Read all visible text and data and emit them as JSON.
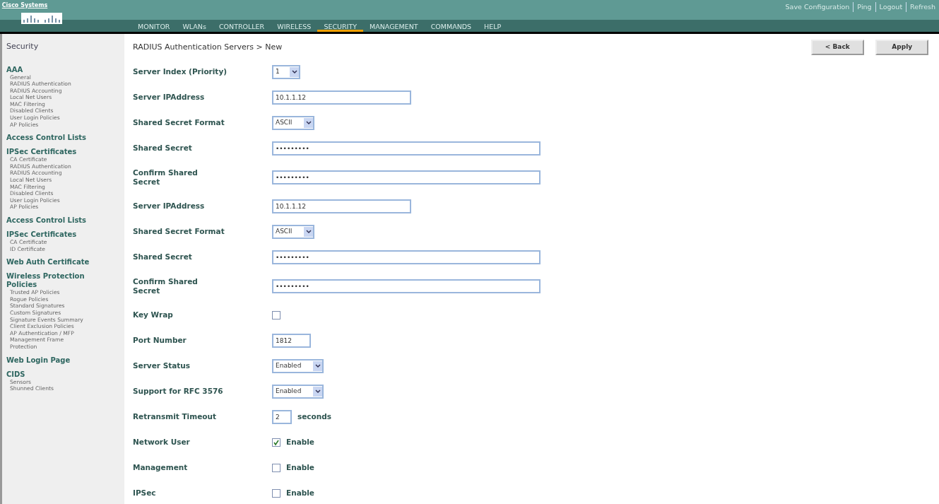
{
  "logo": {
    "text": "Cisco Systems"
  },
  "top_links": [
    "Save Configuration",
    "Ping",
    "Logout",
    "Refresh"
  ],
  "nav": [
    {
      "label": "MONITOR",
      "selected": false
    },
    {
      "label": "WLANs",
      "selected": false
    },
    {
      "label": "CONTROLLER",
      "selected": false
    },
    {
      "label": "WIRELESS",
      "selected": false
    },
    {
      "label": "SECURITY",
      "selected": true
    },
    {
      "label": "MANAGEMENT",
      "selected": false
    },
    {
      "label": "COMMANDS",
      "selected": false
    },
    {
      "label": "HELP",
      "selected": false
    }
  ],
  "sidebar": {
    "title": "Security",
    "sections": [
      {
        "heading": "AAA",
        "items": [
          "General",
          "RADIUS Authentication",
          "RADIUS Accounting",
          "Local Net Users",
          "MAC Filtering",
          "Disabled Clients",
          "User Login Policies",
          "AP Policies"
        ]
      },
      {
        "heading": "Access Control Lists"
      },
      {
        "heading": "IPSec Certificates",
        "items": [
          "CA Certificate",
          "RADIUS Authentication",
          "RADIUS Accounting",
          "Local Net Users",
          "MAC Filtering",
          "Disabled Clients",
          "User Login Policies",
          "AP Policies"
        ]
      },
      {
        "heading": "Access Control Lists"
      },
      {
        "heading": "IPSec Certificates",
        "items": [
          "CA Certificate",
          "ID Certificate"
        ]
      },
      {
        "heading": "Web Auth Certificate"
      },
      {
        "heading": "Wireless Protection Policies",
        "items": [
          "Trusted AP Policies",
          "Rogue Policies",
          "Standard Signatures",
          "Custom Signatures",
          "Signature Events Summary",
          "Client Exclusion Policies",
          "AP Authentication / MFP",
          "Management Frame Protection"
        ]
      },
      {
        "heading": "Web Login Page"
      },
      {
        "heading": "CIDS",
        "items": [
          "Sensors",
          "Shunned Clients"
        ]
      }
    ]
  },
  "page_title": "RADIUS Authentication Servers > New",
  "buttons": [
    "< Back",
    "Apply"
  ],
  "fields": [
    {
      "label": "Server Index (Priority)",
      "kind": "select",
      "value": "1"
    },
    {
      "label": "Server IPAddress",
      "kind": "text",
      "value": "10.1.1.12"
    },
    {
      "label": "Shared Secret Format",
      "kind": "select",
      "value": "ASCII"
    },
    {
      "label": "Shared Secret",
      "kind": "text",
      "value": "•••••••••"
    },
    {
      "label": "Confirm Shared Secret",
      "kind": "text",
      "value": "•••••••••"
    },
    {
      "label": "Server IPAddress",
      "kind": "text",
      "value": "10.1.1.12"
    },
    {
      "label": "Shared Secret Format",
      "kind": "select",
      "value": "ASCII"
    },
    {
      "label": "Shared Secret",
      "kind": "text",
      "value": "•••••••••"
    },
    {
      "label": "Confirm Shared Secret",
      "kind": "text",
      "value": "•••••••••"
    },
    {
      "label": "Key Wrap",
      "kind": "checkbox",
      "checked": false
    },
    {
      "label": "Port Number",
      "kind": "text",
      "value": "1812"
    },
    {
      "label": "Server Status",
      "kind": "select",
      "value": "Enabled"
    },
    {
      "label": "Support for RFC 3576",
      "kind": "select",
      "value": "Enabled"
    },
    {
      "label": "Retransmit Timeout",
      "kind": "text",
      "value": "2",
      "suffix": "seconds"
    },
    {
      "label": "Network User",
      "kind": "checkbox",
      "checked": true,
      "suffix": "Enable"
    },
    {
      "label": "Management",
      "kind": "checkbox",
      "checked": false,
      "suffix": "Enable"
    },
    {
      "label": "IPSec",
      "kind": "checkbox",
      "checked": false,
      "suffix": "Enable"
    }
  ]
}
